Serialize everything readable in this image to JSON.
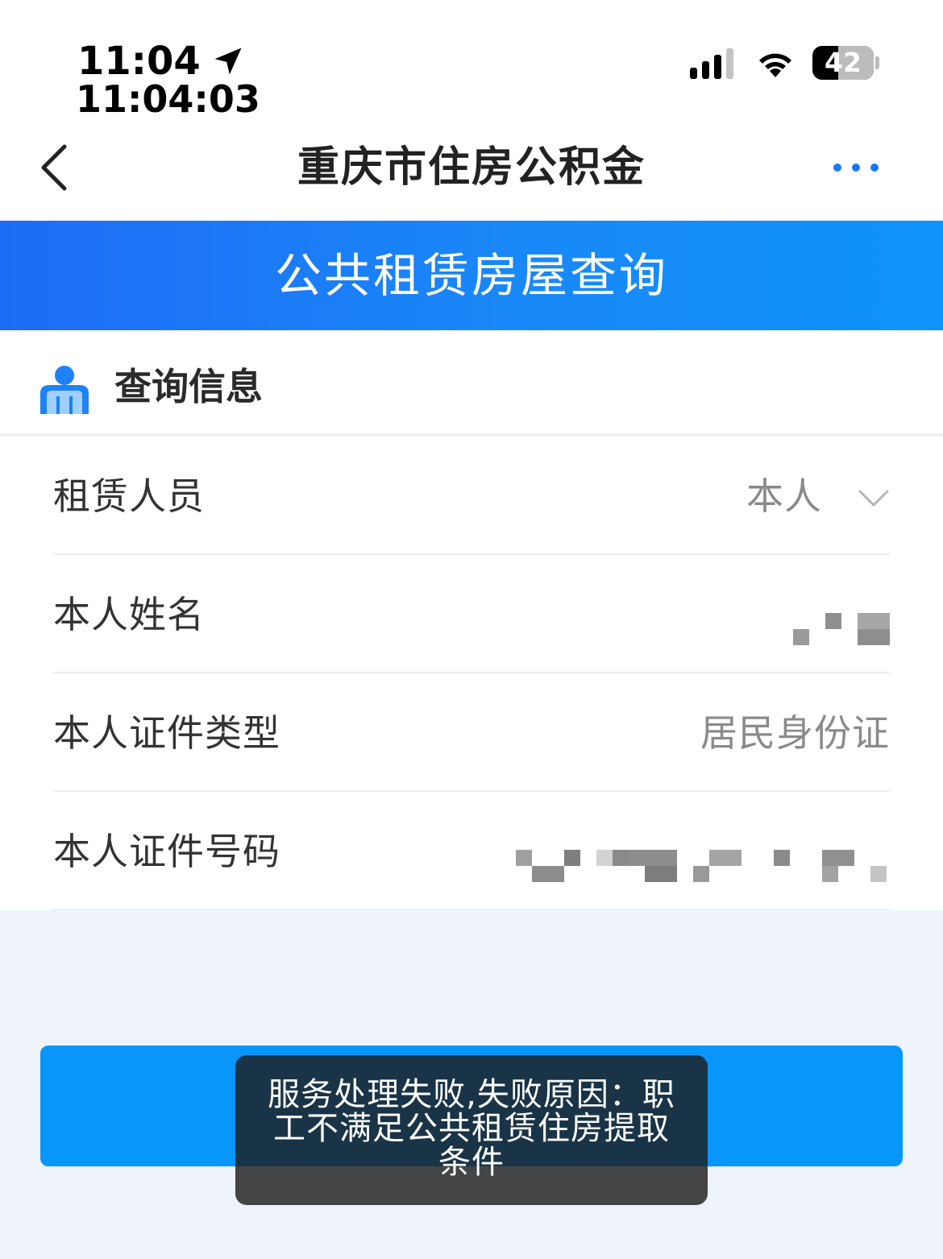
{
  "status_bar": {
    "time": "11:04",
    "time_seconds": "11:04:03",
    "battery": "42"
  },
  "nav": {
    "title": "重庆市住房公积金"
  },
  "banner": {
    "title": "公共租赁房屋查询"
  },
  "section": {
    "title": "查询信息"
  },
  "form": {
    "rows": [
      {
        "label": "租赁人员",
        "value": "本人"
      },
      {
        "label": "本人姓名",
        "value": ""
      },
      {
        "label": "本人证件类型",
        "value": "居民身份证"
      },
      {
        "label": "本人证件号码",
        "value": ""
      }
    ]
  },
  "toast": {
    "message": "服务处理失败,失败原因：职工不满足公共租赁住房提取条件"
  },
  "icons": {
    "back": "chevron-left-icon",
    "more": "more-dots-icon",
    "section": "person-icon",
    "dropdown": "chevron-down-icon"
  },
  "colors": {
    "accent": "#1677ff",
    "banner_start": "#1e6cf5",
    "banner_end": "#0e93fb",
    "button": "#0896fb"
  }
}
